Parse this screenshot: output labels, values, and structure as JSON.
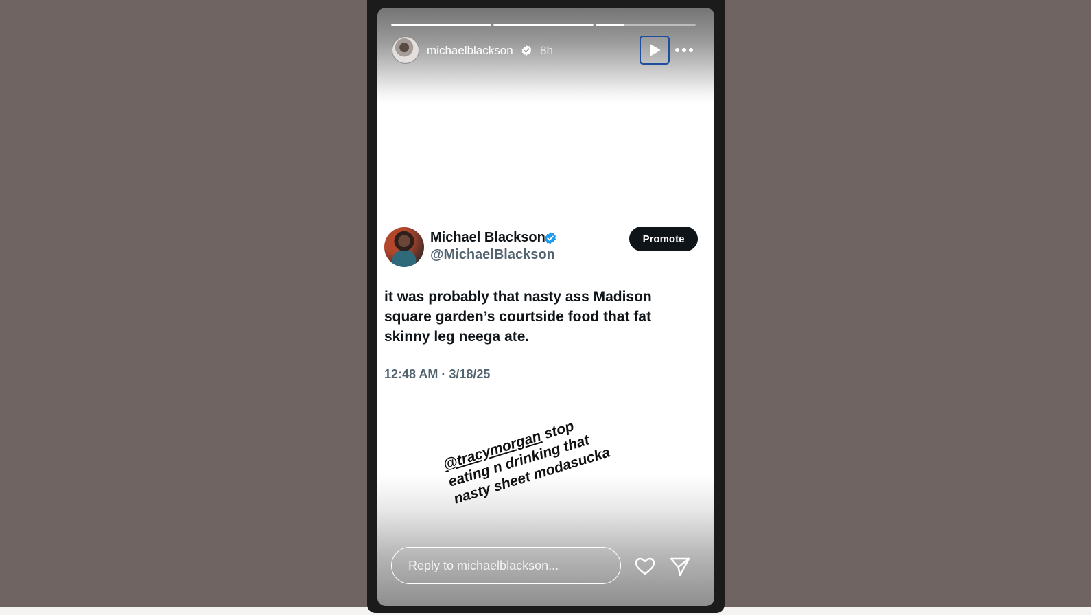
{
  "story": {
    "progress": [
      1.0,
      1.0,
      0.28
    ],
    "author": {
      "username": "michaelblackson",
      "verified_icon": "verified-badge-icon",
      "time": "8h"
    },
    "controls": {
      "play_icon": "play-icon",
      "more_icon": "more-horizontal-icon"
    },
    "sticker": {
      "mention": "@tracymorgan",
      "line1_rest": " stop",
      "line2": "eating n drinking that",
      "line3": "nasty sheet modasucka"
    },
    "reply": {
      "placeholder": "Reply to michaelblackson...",
      "like_icon": "heart-icon",
      "share_icon": "send-icon"
    }
  },
  "tweet": {
    "display_name": "Michael Blackson",
    "handle": "@MichaelBlackson",
    "promote_label": "Promote",
    "text": "it was probably that nasty ass Madison square garden’s courtside food that fat skinny leg neega ate.",
    "timestamp": "12:48 AM · 3/18/25",
    "verified_color": "#1d9bf0"
  },
  "colors": {
    "background": "#6f6462",
    "phone_frame": "#1c1b1b",
    "focus_outline": "#1d4ea0"
  }
}
